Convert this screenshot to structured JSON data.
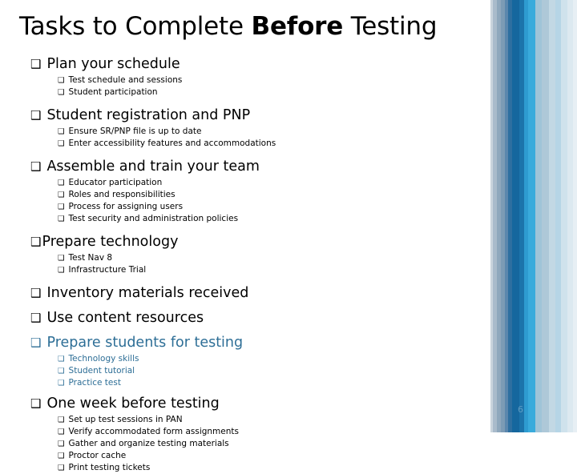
{
  "slide": {
    "title_part1": "Tasks to Complete ",
    "title_bold": "Before",
    "title_part2": " Testing",
    "page_number": "6",
    "checkbox_glyph": "❑",
    "accent_blue": "#2D6E96"
  },
  "stripes": [
    {
      "name": "stripe-1",
      "color": "#C9D4DD",
      "width": 3
    },
    {
      "name": "stripe-2",
      "color": "#A9BBCB",
      "width": 5
    },
    {
      "name": "stripe-3",
      "color": "#8FA8BD",
      "width": 5
    },
    {
      "name": "stripe-4",
      "color": "#7C9BB5",
      "width": 5
    },
    {
      "name": "stripe-5",
      "color": "#5C87AD",
      "width": 4
    },
    {
      "name": "stripe-6",
      "color": "#2E6FA0",
      "width": 5
    },
    {
      "name": "stripe-7",
      "color": "#15679E",
      "width": 9
    },
    {
      "name": "stripe-8",
      "color": "#1C74AB",
      "width": 6
    },
    {
      "name": "stripe-9",
      "color": "#2E9BD0",
      "width": 5
    },
    {
      "name": "stripe-10",
      "color": "#39ABDC",
      "width": 9
    },
    {
      "name": "stripe-11",
      "color": "#9FC4D8",
      "width": 8
    },
    {
      "name": "stripe-12",
      "color": "#AEC8D8",
      "width": 9
    },
    {
      "name": "stripe-13",
      "color": "#C2D8E4",
      "width": 8
    },
    {
      "name": "stripe-14",
      "color": "#B6D5E6",
      "width": 7
    },
    {
      "name": "stripe-15",
      "color": "#CFE2EC",
      "width": 8
    },
    {
      "name": "stripe-16",
      "color": "#DCE9F0",
      "width": 7
    },
    {
      "name": "stripe-17",
      "color": "#E7EFF4",
      "width": 5
    }
  ],
  "groups": [
    {
      "id": "plan-your-schedule",
      "heading": "Plan your schedule",
      "blue": false,
      "tight": false,
      "subitems": [
        "Test schedule and sessions",
        "Student participation"
      ]
    },
    {
      "id": "student-registration-and-pnp",
      "heading": "Student registration and PNP",
      "blue": false,
      "tight": false,
      "subitems": [
        "Ensure SR/PNP file is up to date",
        "Enter accessibility features and accommodations"
      ]
    },
    {
      "id": "assemble-and-train-your-team",
      "heading": "Assemble and train your team",
      "blue": false,
      "tight": false,
      "subitems": [
        "Educator participation",
        "Roles and responsibilities",
        "Process for assigning users",
        "Test security and administration policies"
      ]
    },
    {
      "id": "prepare-technology",
      "heading": "Prepare technology",
      "blue": false,
      "tight": true,
      "subitems": [
        "Test Nav 8",
        "Infrastructure Trial"
      ]
    },
    {
      "id": "inventory-materials-received",
      "heading": "Inventory materials received",
      "blue": false,
      "tight": false,
      "subitems": []
    },
    {
      "id": "use-content-resources",
      "heading": "Use content resources",
      "blue": false,
      "tight": false,
      "subitems": []
    },
    {
      "id": "prepare-students-for-testing",
      "heading": "Prepare students for testing",
      "blue": true,
      "tight": false,
      "subitems": [
        "Technology skills",
        "Student tutorial",
        "Practice test"
      ]
    },
    {
      "id": "one-week-before-testing",
      "heading": "One week before testing",
      "blue": false,
      "tight": false,
      "subitems": [
        "Set up test sessions in PAN",
        "Verify accommodated form assignments",
        "Gather and organize testing materials",
        "Proctor cache",
        "Print testing tickets"
      ]
    }
  ]
}
